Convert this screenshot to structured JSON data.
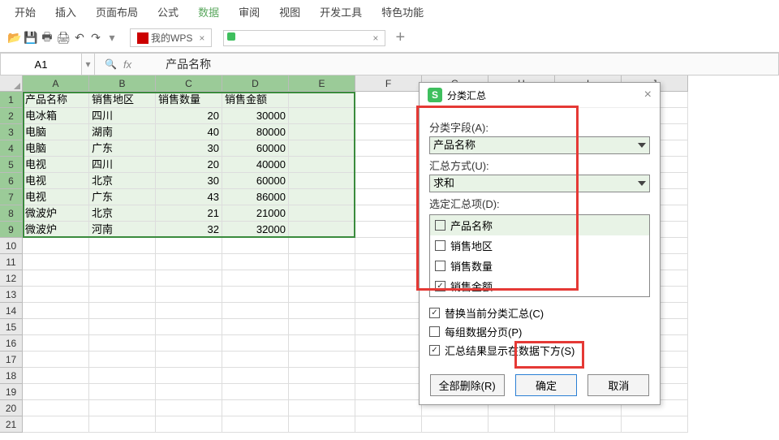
{
  "menu": [
    "开始",
    "插入",
    "页面布局",
    "公式",
    "数据",
    "审阅",
    "视图",
    "开发工具",
    "特色功能"
  ],
  "menu_active_index": 4,
  "tabs": {
    "wps_tab": "我的WPS",
    "blank_tab_close": "×"
  },
  "formula_bar": {
    "name_box": "A1",
    "fx": "fx",
    "content": "产品名称"
  },
  "columns": [
    "A",
    "B",
    "C",
    "D",
    "E",
    "F",
    "G",
    "H",
    "I",
    "J"
  ],
  "selected_cols": [
    0,
    1,
    2,
    3,
    4
  ],
  "rows_visible": 21,
  "selected_rows": [
    1,
    2,
    3,
    4,
    5,
    6,
    7,
    8,
    9
  ],
  "table": [
    [
      "产品名称",
      "销售地区",
      "销售数量",
      "销售金额"
    ],
    [
      "电冰箱",
      "四川",
      "20",
      "30000"
    ],
    [
      "电脑",
      "湖南",
      "40",
      "80000"
    ],
    [
      "电脑",
      "广东",
      "30",
      "60000"
    ],
    [
      "电视",
      "四川",
      "20",
      "40000"
    ],
    [
      "电视",
      "北京",
      "30",
      "60000"
    ],
    [
      "电视",
      "广东",
      "43",
      "86000"
    ],
    [
      "微波炉",
      "北京",
      "21",
      "21000"
    ],
    [
      "微波炉",
      "河南",
      "32",
      "32000"
    ]
  ],
  "dialog": {
    "title": "分类汇总",
    "field_label": "分类字段(A):",
    "field_value": "产品名称",
    "method_label": "汇总方式(U):",
    "method_value": "求和",
    "items_label": "选定汇总项(D):",
    "items": [
      {
        "label": "产品名称",
        "checked": false
      },
      {
        "label": "销售地区",
        "checked": false
      },
      {
        "label": "销售数量",
        "checked": false
      },
      {
        "label": "销售金额",
        "checked": true
      }
    ],
    "replace_label": "替换当前分类汇总(C)",
    "replace_checked": true,
    "page_break_label": "每组数据分页(P)",
    "page_break_checked": false,
    "below_label": "汇总结果显示在数据下方(S)",
    "below_checked": true,
    "remove_all": "全部删除(R)",
    "ok": "确定",
    "cancel": "取消"
  }
}
